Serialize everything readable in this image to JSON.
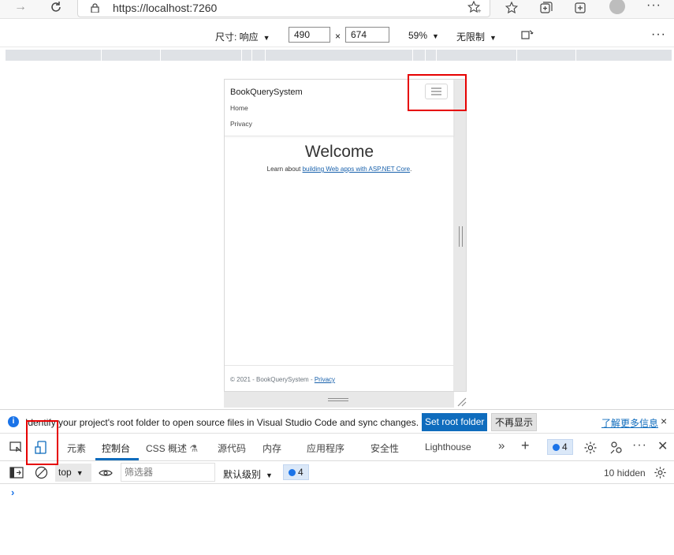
{
  "browser": {
    "url": "https://localhost:7260",
    "icons": [
      "forward-icon",
      "refresh-icon",
      "lock-icon",
      "add-favorite-icon",
      "favorites-icon",
      "collections-icon",
      "browser-essentials-icon",
      "profile-avatar",
      "more-icon"
    ]
  },
  "device_toolbar": {
    "dimensions_label": "尺寸: 响应",
    "width": "490",
    "times": "×",
    "height": "674",
    "zoom": "59%",
    "throttle": "无限制"
  },
  "page": {
    "brand": "BookQuerySystem",
    "nav": [
      "Home",
      "Privacy"
    ],
    "welcome": "Welcome",
    "learn_prefix": "Learn about ",
    "learn_link": "building Web apps with ASP.NET Core",
    "learn_suffix": ".",
    "footer_text": "© 2021 - BookQuerySystem - ",
    "footer_link": "Privacy"
  },
  "infobar": {
    "message": "Identify your project's root folder to open source files in Visual Studio Code and sync changes.",
    "set_root": "Set root folder",
    "dismiss": "不再显示",
    "learn_more": "了解更多信息",
    "close": "×"
  },
  "devtools": {
    "tabs": [
      "元素",
      "控制台",
      "CSS 概述",
      "源代码",
      "内存",
      "应用程序",
      "安全性",
      "Lighthouse"
    ],
    "active_tab": "控制台",
    "message_count": "4"
  },
  "console": {
    "context": "top",
    "filter_placeholder": "筛选器",
    "level": "默认级别",
    "message_count": "4",
    "hidden": "10 hidden",
    "prompt": "›"
  },
  "colors": {
    "accent": "#0f6cbd",
    "highlight": "#e60000",
    "link": "#1861ac"
  }
}
